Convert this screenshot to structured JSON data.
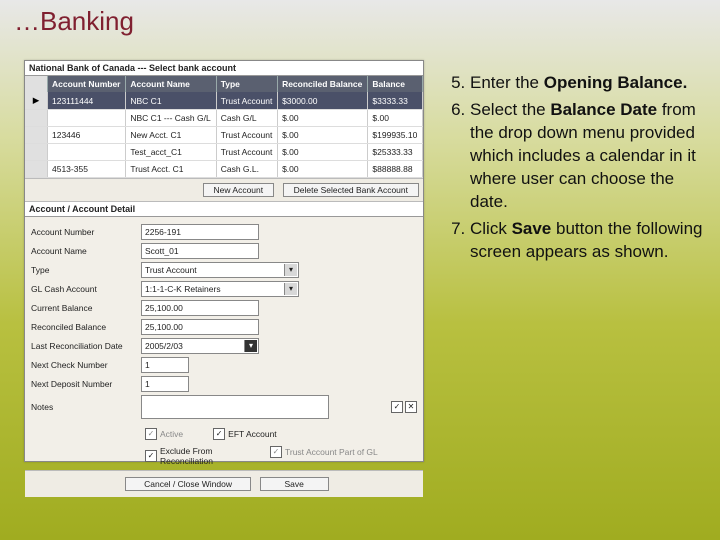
{
  "title": "…Banking",
  "bank_header": "National Bank of Canada --- Select bank account",
  "cols": {
    "c1": "Account Number",
    "c2": "Account Name",
    "c3": "Type",
    "c4": "Reconciled Balance",
    "c5": "Balance"
  },
  "rows": [
    {
      "num": "123111444",
      "name": "NBC C1",
      "type": "Trust Account",
      "recon": "$3000.00",
      "bal": "$3333.33"
    },
    {
      "num": "",
      "name": "NBC C1 --- Cash G/L",
      "type": "Cash G/L",
      "recon": "$.00",
      "bal": "$.00"
    },
    {
      "num": "123446",
      "name": "New Acct. C1",
      "type": "Trust Account",
      "recon": "$.00",
      "bal": "$199935.10"
    },
    {
      "num": "",
      "name": "Test_acct_C1",
      "type": "Trust Account",
      "recon": "$.00",
      "bal": "$25333.33"
    },
    {
      "num": "4513-355",
      "name": "Trust Acct. C1",
      "type": "Cash G.L.",
      "recon": "$.00",
      "bal": "$88888.88"
    }
  ],
  "btn_new": "New Account",
  "btn_del": "Delete Selected Bank Account",
  "section": "Account / Account Detail",
  "form": {
    "acc_num_l": "Account Number",
    "acc_num_v": "2256-191",
    "acc_name_l": "Account Name",
    "acc_name_v": "Scott_01",
    "type_l": "Type",
    "type_v": "Trust Account",
    "gl_l": "GL Cash Account",
    "gl_v": "1:1-1-C-K Retainers",
    "cur_l": "Current Balance",
    "cur_v": "25,100.00",
    "rec_l": "Reconciled Balance",
    "rec_v": "25,100.00",
    "lrd_l": "Last Reconciliation Date",
    "lrd_v": "2005/2/03",
    "ncn_l": "Next Check Number",
    "ncn_v": "1",
    "ndn_l": "Next Deposit Number",
    "ndn_v": "1",
    "notes_l": "Notes",
    "notes_v": ""
  },
  "cb": {
    "active": "Active",
    "eft": "EFT Account",
    "excl": "Exclude From Reconciliation",
    "trust": "Trust Account Part of GL"
  },
  "btn_save": "Save",
  "btn_cancel": "Cancel / Close Window",
  "instr": {
    "i5a": "Enter the ",
    "i5b": "Opening Balance.",
    "i6a": "Select the ",
    "i6b": "Balance Date",
    "i6c": " from the drop down menu provided which includes a calendar in it where user can choose the date.",
    "i7a": "Click ",
    "i7b": "Save",
    "i7c": " button the following screen appears as shown."
  }
}
